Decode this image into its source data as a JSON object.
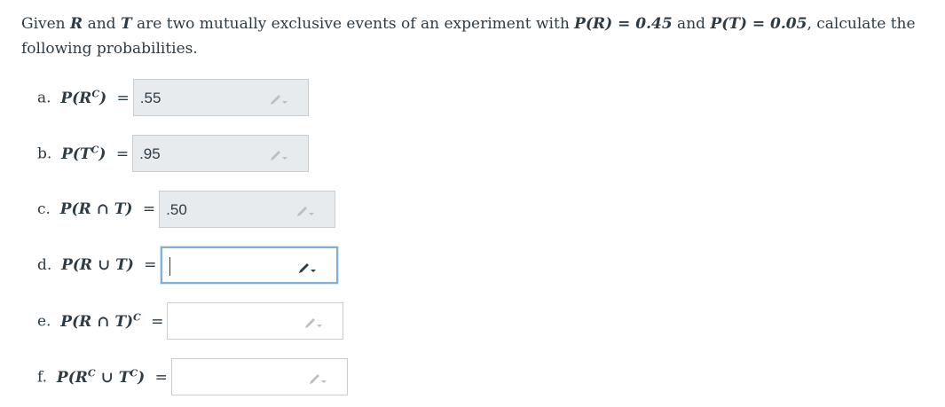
{
  "question": {
    "intro": "Given ",
    "event_r": "R",
    "and": " and ",
    "event_t": "T",
    "middle": " are two mutually exclusive events of an experiment with ",
    "p_r": "P(R) = 0.45",
    "and2": " and ",
    "p_t": "P(T) = 0.05",
    "end": ", calculate the following probabilities."
  },
  "parts": [
    {
      "letter": "a.",
      "expression": "P(R",
      "sup": "C",
      "tail": ")",
      "equals": "=",
      "value": ".55",
      "state": "filled"
    },
    {
      "letter": "b.",
      "expression": "P(T",
      "sup": "C",
      "tail": ")",
      "equals": "=",
      "value": ".95",
      "state": "filled"
    },
    {
      "letter": "c.",
      "expression": "P(R ∩ T)",
      "sup": "",
      "tail": "",
      "equals": "=",
      "value": ".50",
      "state": "filled"
    },
    {
      "letter": "d.",
      "expression": "P(R ∪ T)",
      "sup": "",
      "tail": "",
      "equals": "=",
      "value": "",
      "state": "focused"
    },
    {
      "letter": "e.",
      "expression": "P(R ∩ T)",
      "sup": "C",
      "tail": "",
      "equals": "=",
      "value": "",
      "state": "empty"
    },
    {
      "letter": "f.",
      "expression": "P(R",
      "sup": "C",
      "tail": " ∪ T",
      "sup2": "C",
      "tail2": ")",
      "equals": "=",
      "value": "",
      "state": "empty"
    }
  ],
  "icons": {
    "edit": "pencil-dropdown-icon"
  },
  "colors": {
    "filled_bg": "#e8ebee",
    "focus_border": "#7fb0d9",
    "text": "#2d3b45"
  }
}
